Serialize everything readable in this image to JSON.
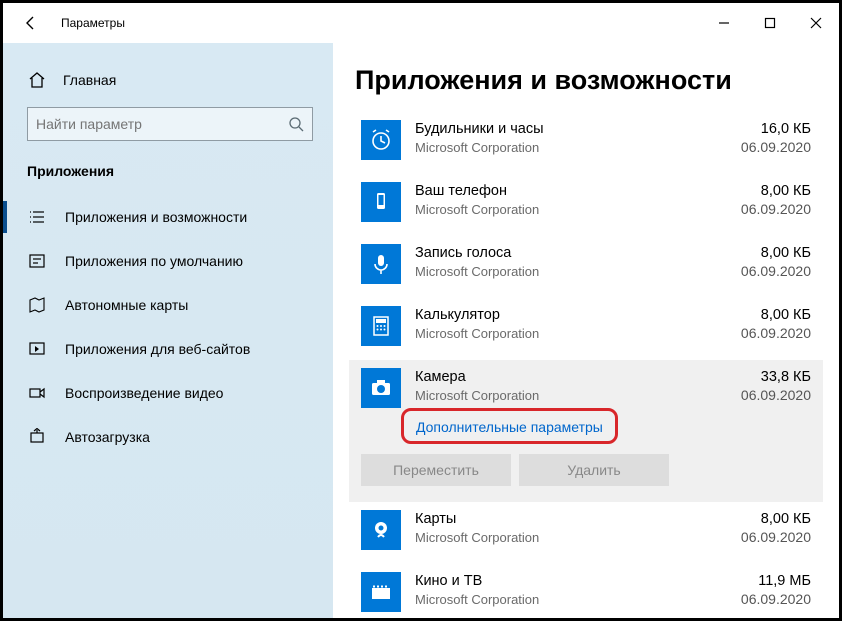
{
  "titlebar": {
    "title": "Параметры"
  },
  "sidebar": {
    "home": "Главная",
    "search_placeholder": "Найти параметр",
    "category": "Приложения",
    "items": [
      {
        "label": "Приложения и возможности"
      },
      {
        "label": "Приложения по умолчанию"
      },
      {
        "label": "Автономные карты"
      },
      {
        "label": "Приложения для веб-сайтов"
      },
      {
        "label": "Воспроизведение видео"
      },
      {
        "label": "Автозагрузка"
      }
    ]
  },
  "main": {
    "heading": "Приложения и возможности",
    "advanced_label": "Дополнительные параметры",
    "move_label": "Переместить",
    "delete_label": "Удалить",
    "apps": [
      {
        "name": "Будильники и часы",
        "publisher": "Microsoft Corporation",
        "size": "16,0 КБ",
        "date": "06.09.2020"
      },
      {
        "name": "Ваш телефон",
        "publisher": "Microsoft Corporation",
        "size": "8,00 КБ",
        "date": "06.09.2020"
      },
      {
        "name": "Запись голоса",
        "publisher": "Microsoft Corporation",
        "size": "8,00 КБ",
        "date": "06.09.2020"
      },
      {
        "name": "Калькулятор",
        "publisher": "Microsoft Corporation",
        "size": "8,00 КБ",
        "date": "06.09.2020"
      },
      {
        "name": "Камера",
        "publisher": "Microsoft Corporation",
        "size": "33,8 КБ",
        "date": "06.09.2020"
      },
      {
        "name": "Карты",
        "publisher": "Microsoft Corporation",
        "size": "8,00 КБ",
        "date": "06.09.2020"
      },
      {
        "name": "Кино и ТВ",
        "publisher": "Microsoft Corporation",
        "size": "11,9 МБ",
        "date": "06.09.2020"
      }
    ]
  }
}
